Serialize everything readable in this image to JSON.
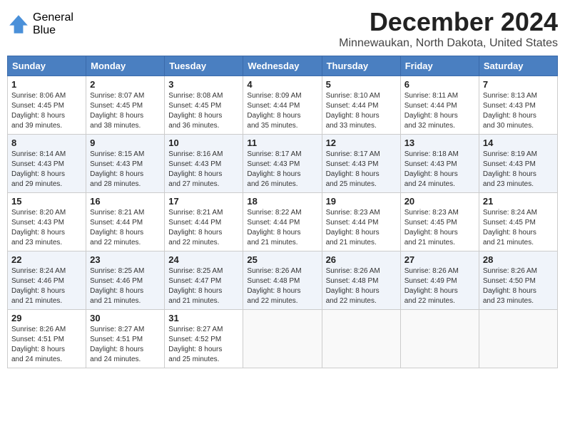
{
  "logo": {
    "general": "General",
    "blue": "Blue"
  },
  "title": "December 2024",
  "location": "Minnewaukan, North Dakota, United States",
  "days_of_week": [
    "Sunday",
    "Monday",
    "Tuesday",
    "Wednesday",
    "Thursday",
    "Friday",
    "Saturday"
  ],
  "weeks": [
    [
      {
        "day": 1,
        "info": "Sunrise: 8:06 AM\nSunset: 4:45 PM\nDaylight: 8 hours\nand 39 minutes."
      },
      {
        "day": 2,
        "info": "Sunrise: 8:07 AM\nSunset: 4:45 PM\nDaylight: 8 hours\nand 38 minutes."
      },
      {
        "day": 3,
        "info": "Sunrise: 8:08 AM\nSunset: 4:45 PM\nDaylight: 8 hours\nand 36 minutes."
      },
      {
        "day": 4,
        "info": "Sunrise: 8:09 AM\nSunset: 4:44 PM\nDaylight: 8 hours\nand 35 minutes."
      },
      {
        "day": 5,
        "info": "Sunrise: 8:10 AM\nSunset: 4:44 PM\nDaylight: 8 hours\nand 33 minutes."
      },
      {
        "day": 6,
        "info": "Sunrise: 8:11 AM\nSunset: 4:44 PM\nDaylight: 8 hours\nand 32 minutes."
      },
      {
        "day": 7,
        "info": "Sunrise: 8:13 AM\nSunset: 4:43 PM\nDaylight: 8 hours\nand 30 minutes."
      }
    ],
    [
      {
        "day": 8,
        "info": "Sunrise: 8:14 AM\nSunset: 4:43 PM\nDaylight: 8 hours\nand 29 minutes."
      },
      {
        "day": 9,
        "info": "Sunrise: 8:15 AM\nSunset: 4:43 PM\nDaylight: 8 hours\nand 28 minutes."
      },
      {
        "day": 10,
        "info": "Sunrise: 8:16 AM\nSunset: 4:43 PM\nDaylight: 8 hours\nand 27 minutes."
      },
      {
        "day": 11,
        "info": "Sunrise: 8:17 AM\nSunset: 4:43 PM\nDaylight: 8 hours\nand 26 minutes."
      },
      {
        "day": 12,
        "info": "Sunrise: 8:17 AM\nSunset: 4:43 PM\nDaylight: 8 hours\nand 25 minutes."
      },
      {
        "day": 13,
        "info": "Sunrise: 8:18 AM\nSunset: 4:43 PM\nDaylight: 8 hours\nand 24 minutes."
      },
      {
        "day": 14,
        "info": "Sunrise: 8:19 AM\nSunset: 4:43 PM\nDaylight: 8 hours\nand 23 minutes."
      }
    ],
    [
      {
        "day": 15,
        "info": "Sunrise: 8:20 AM\nSunset: 4:43 PM\nDaylight: 8 hours\nand 23 minutes."
      },
      {
        "day": 16,
        "info": "Sunrise: 8:21 AM\nSunset: 4:44 PM\nDaylight: 8 hours\nand 22 minutes."
      },
      {
        "day": 17,
        "info": "Sunrise: 8:21 AM\nSunset: 4:44 PM\nDaylight: 8 hours\nand 22 minutes."
      },
      {
        "day": 18,
        "info": "Sunrise: 8:22 AM\nSunset: 4:44 PM\nDaylight: 8 hours\nand 21 minutes."
      },
      {
        "day": 19,
        "info": "Sunrise: 8:23 AM\nSunset: 4:44 PM\nDaylight: 8 hours\nand 21 minutes."
      },
      {
        "day": 20,
        "info": "Sunrise: 8:23 AM\nSunset: 4:45 PM\nDaylight: 8 hours\nand 21 minutes."
      },
      {
        "day": 21,
        "info": "Sunrise: 8:24 AM\nSunset: 4:45 PM\nDaylight: 8 hours\nand 21 minutes."
      }
    ],
    [
      {
        "day": 22,
        "info": "Sunrise: 8:24 AM\nSunset: 4:46 PM\nDaylight: 8 hours\nand 21 minutes."
      },
      {
        "day": 23,
        "info": "Sunrise: 8:25 AM\nSunset: 4:46 PM\nDaylight: 8 hours\nand 21 minutes."
      },
      {
        "day": 24,
        "info": "Sunrise: 8:25 AM\nSunset: 4:47 PM\nDaylight: 8 hours\nand 21 minutes."
      },
      {
        "day": 25,
        "info": "Sunrise: 8:26 AM\nSunset: 4:48 PM\nDaylight: 8 hours\nand 22 minutes."
      },
      {
        "day": 26,
        "info": "Sunrise: 8:26 AM\nSunset: 4:48 PM\nDaylight: 8 hours\nand 22 minutes."
      },
      {
        "day": 27,
        "info": "Sunrise: 8:26 AM\nSunset: 4:49 PM\nDaylight: 8 hours\nand 22 minutes."
      },
      {
        "day": 28,
        "info": "Sunrise: 8:26 AM\nSunset: 4:50 PM\nDaylight: 8 hours\nand 23 minutes."
      }
    ],
    [
      {
        "day": 29,
        "info": "Sunrise: 8:26 AM\nSunset: 4:51 PM\nDaylight: 8 hours\nand 24 minutes."
      },
      {
        "day": 30,
        "info": "Sunrise: 8:27 AM\nSunset: 4:51 PM\nDaylight: 8 hours\nand 24 minutes."
      },
      {
        "day": 31,
        "info": "Sunrise: 8:27 AM\nSunset: 4:52 PM\nDaylight: 8 hours\nand 25 minutes."
      },
      null,
      null,
      null,
      null
    ]
  ]
}
